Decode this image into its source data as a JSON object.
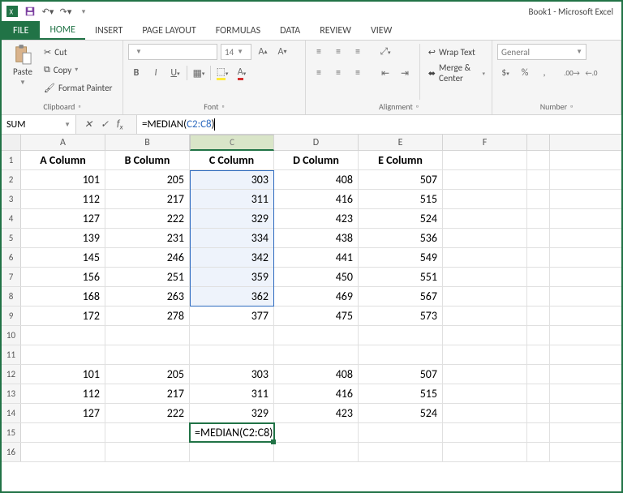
{
  "app": {
    "title": "Book1 - Microsoft Excel"
  },
  "qat": {
    "save": "save",
    "undo": "undo",
    "redo": "redo"
  },
  "tabs": {
    "file": "FILE",
    "items": [
      "HOME",
      "INSERT",
      "PAGE LAYOUT",
      "FORMULAS",
      "DATA",
      "REVIEW",
      "VIEW"
    ],
    "active": 0
  },
  "ribbon": {
    "clipboard": {
      "paste": "Paste",
      "cut": "Cut",
      "copy": "Copy",
      "format_painter": "Format Painter",
      "label": "Clipboard"
    },
    "font": {
      "font_name": "",
      "font_size": "14",
      "label": "Font"
    },
    "alignment": {
      "wrap": "Wrap Text",
      "merge": "Merge & Center",
      "label": "Alignment"
    },
    "number": {
      "format": "General",
      "label": "Number"
    }
  },
  "formula_bar": {
    "name_box": "SUM",
    "formula_pre": "=MEDIAN(",
    "formula_ref": "C2:C8",
    "formula_post": ")"
  },
  "grid": {
    "columns": [
      "A",
      "B",
      "C",
      "D",
      "E",
      "F"
    ],
    "row_numbers": [
      "1",
      "2",
      "3",
      "4",
      "5",
      "6",
      "7",
      "8",
      "9",
      "10",
      "11",
      "12",
      "13",
      "14",
      "15",
      "16"
    ],
    "headers": [
      "A Column",
      "B Column",
      "C Column",
      "D Column",
      "E Column",
      ""
    ],
    "rows": [
      [
        "101",
        "205",
        "303",
        "408",
        "507",
        ""
      ],
      [
        "112",
        "217",
        "311",
        "416",
        "515",
        ""
      ],
      [
        "127",
        "222",
        "329",
        "423",
        "524",
        ""
      ],
      [
        "139",
        "231",
        "334",
        "438",
        "536",
        ""
      ],
      [
        "145",
        "246",
        "342",
        "441",
        "549",
        ""
      ],
      [
        "156",
        "251",
        "359",
        "450",
        "551",
        ""
      ],
      [
        "168",
        "263",
        "362",
        "469",
        "567",
        ""
      ],
      [
        "172",
        "278",
        "377",
        "475",
        "573",
        ""
      ],
      [
        "",
        "",
        "",
        "",
        "",
        ""
      ],
      [
        "",
        "",
        "",
        "",
        "",
        ""
      ],
      [
        "101",
        "205",
        "303",
        "408",
        "507",
        ""
      ],
      [
        "112",
        "217",
        "311",
        "416",
        "515",
        ""
      ],
      [
        "127",
        "222",
        "329",
        "423",
        "524",
        ""
      ],
      [
        "",
        "",
        "=MEDIAN(C2:C8)",
        "",
        "",
        ""
      ],
      [
        "",
        "",
        "",
        "",
        "",
        ""
      ]
    ],
    "selected_col_index": 2,
    "range_sel": {
      "col": 2,
      "r1": 1,
      "r2": 7
    },
    "active_cell": {
      "row": 14,
      "col": 2
    }
  },
  "chart_data": {
    "type": "table",
    "title": "Book1",
    "columns": [
      "A Column",
      "B Column",
      "C Column",
      "D Column",
      "E Column"
    ],
    "rows": [
      [
        101,
        205,
        303,
        408,
        507
      ],
      [
        112,
        217,
        311,
        416,
        515
      ],
      [
        127,
        222,
        329,
        423,
        524
      ],
      [
        139,
        231,
        334,
        438,
        536
      ],
      [
        145,
        246,
        342,
        441,
        549
      ],
      [
        156,
        251,
        359,
        450,
        551
      ],
      [
        168,
        263,
        362,
        469,
        567
      ],
      [
        172,
        278,
        377,
        475,
        573
      ]
    ],
    "formula_cell": "C15",
    "formula": "=MEDIAN(C2:C8)"
  }
}
